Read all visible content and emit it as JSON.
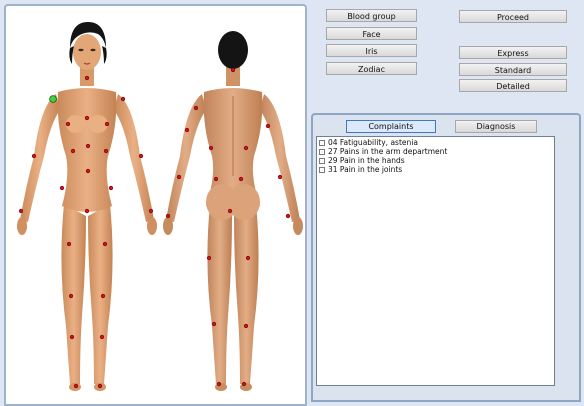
{
  "buttons": {
    "blood_group": "Blood group",
    "face": "Face",
    "iris": "Iris",
    "zodiac": "Zodiac",
    "proceed": "Proceed",
    "express": "Express",
    "standard": "Standard",
    "detailed": "Detailed"
  },
  "tabs": {
    "complaints": "Complaints",
    "diagnosis": "Diagnosis"
  },
  "complaints": [
    "04 Fatiguability, astenia",
    "27 Pains in the arm department",
    "29 Pain in the hands",
    "31 Pain in the joints"
  ],
  "colors": {
    "point": "#d6121d",
    "selected_point": "#3ed13a",
    "panel_border": "#9fb2cc",
    "tab_active_border": "#3d79c8"
  }
}
